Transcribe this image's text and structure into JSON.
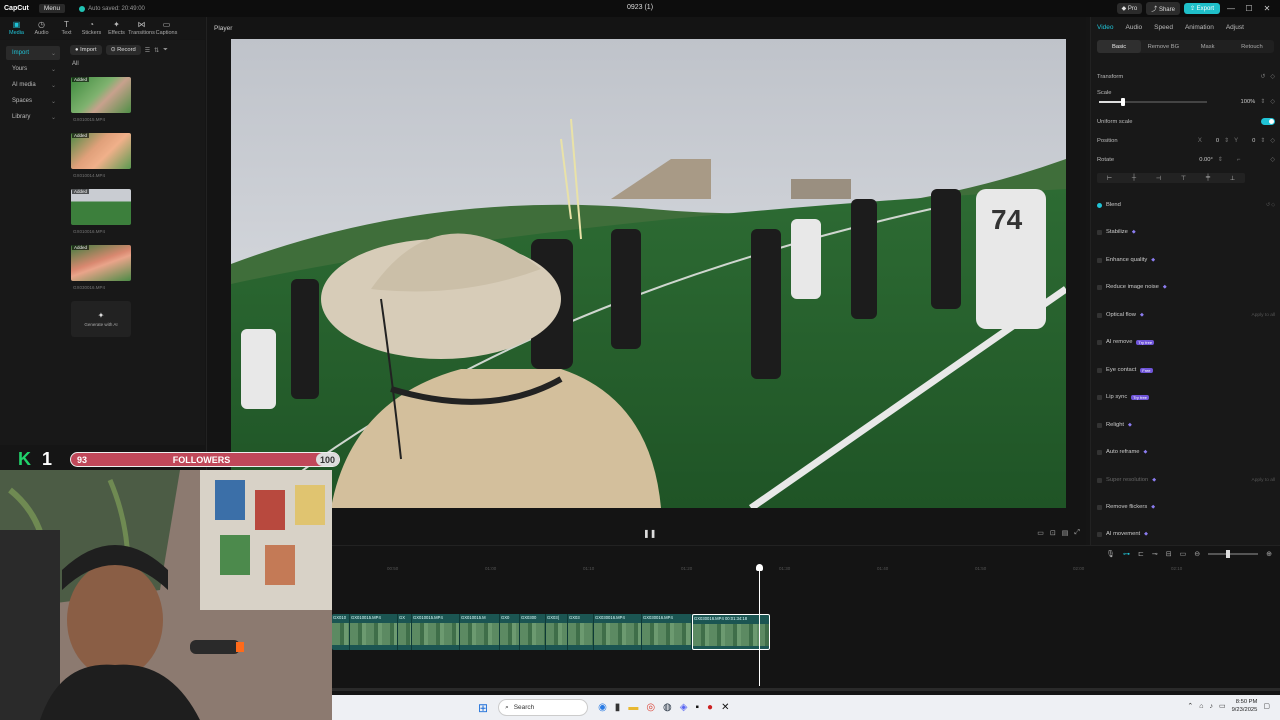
{
  "titlebar": {
    "logo": "CapCut",
    "menu": "Menu",
    "autosave": "Auto saved: 20:49:00",
    "project_title": "0923 (1)",
    "pro": "Pro",
    "share": "Share",
    "export": "Export",
    "win_min": "—",
    "win_max": "☐",
    "win_close": "✕"
  },
  "tooltabs": [
    {
      "label": "Media",
      "icon": "▣"
    },
    {
      "label": "Audio",
      "icon": "◷"
    },
    {
      "label": "Text",
      "icon": "T"
    },
    {
      "label": "Stickers",
      "icon": "◔"
    },
    {
      "label": "Effects",
      "icon": "✦"
    },
    {
      "label": "Transitions",
      "icon": "⋈"
    },
    {
      "label": "Captions",
      "icon": "▭"
    }
  ],
  "sidenav": [
    {
      "label": "Import"
    },
    {
      "label": "Yours"
    },
    {
      "label": "AI media"
    },
    {
      "label": "Spaces"
    },
    {
      "label": "Library"
    }
  ],
  "media": {
    "import_btn": "Import",
    "record_btn": "Record",
    "all": "All",
    "added": "Added",
    "files": [
      "GX010015.MP4",
      "GX010014.MP4",
      "GX010016.MP4",
      "GX030016.MP4"
    ],
    "generate": "Generate with AI"
  },
  "player": {
    "title": "Player"
  },
  "right": {
    "tabs": [
      "Video",
      "Audio",
      "Speed",
      "Animation",
      "Adjust"
    ],
    "subtabs": [
      "Basic",
      "Remove BG",
      "Mask",
      "Retouch"
    ],
    "transform": "Transform",
    "scale": "Scale",
    "scale_val": "100%",
    "uniform": "Uniform scale",
    "position": "Position",
    "pos_x_lbl": "X",
    "pos_x": "0",
    "pos_y_lbl": "Y",
    "pos_y": "0",
    "rotate": "Rotate",
    "rotate_val": "0.00°",
    "blend": "Blend",
    "features": [
      {
        "label": "Stabilize"
      },
      {
        "label": "Enhance quality"
      },
      {
        "label": "Reduce image noise"
      },
      {
        "label": "Optical flow",
        "extra": "Apply to all"
      },
      {
        "label": "AI remove",
        "badge": "Try free"
      },
      {
        "label": "Eye contact",
        "badge": "Free"
      },
      {
        "label": "Lip sync",
        "badge": "Try free"
      },
      {
        "label": "Relight"
      },
      {
        "label": "Auto reframe"
      },
      {
        "label": "Super resolution",
        "dim": true,
        "extra": "Apply to all"
      },
      {
        "label": "Remove flickers"
      },
      {
        "label": "AI movement"
      }
    ]
  },
  "hud": {
    "k": "K",
    "level": "1",
    "start": "93",
    "label": "FOLLOWERS",
    "end": "100"
  },
  "timeline": {
    "ruler": [
      "00:50",
      "01:00",
      "01:10",
      "01:20",
      "01:30",
      "01:40",
      "01:50",
      "02:00",
      "02:10"
    ],
    "clips": [
      {
        "name": "GX010"
      },
      {
        "name": "GX010015.MP4"
      },
      {
        "name": "GX"
      },
      {
        "name": "GX010015.MP4"
      },
      {
        "name": "GX010015.M"
      },
      {
        "name": "GX0"
      },
      {
        "name": "GX0300"
      },
      {
        "name": "GX03("
      },
      {
        "name": "GX03"
      },
      {
        "name": "GX030016.MP4"
      },
      {
        "name": "GX030016.MP4"
      },
      {
        "name": "GX030016.MP4  00:01:34:18"
      }
    ]
  },
  "taskbar": {
    "search": "Search",
    "time": "8:50 PM",
    "date": "9/23/2025"
  }
}
